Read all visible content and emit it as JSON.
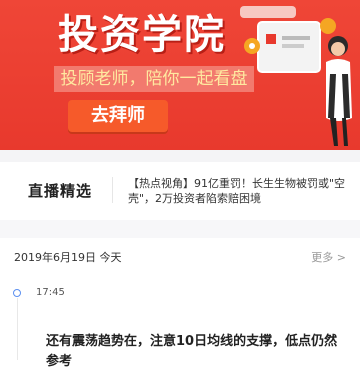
{
  "banner": {
    "title": "投资学院",
    "subtitle": "投顾老师，陪你一起看盘",
    "cta_label": "去拜师"
  },
  "live": {
    "tag": "直播精选",
    "news": "【热点视角】91亿重罚！长生生物被罚或\"空壳\"，2万投资者陷索赔困境"
  },
  "date_header": {
    "date": "2019年6月19日 今天",
    "more": "更多 >"
  },
  "timeline": {
    "time": "17:45",
    "text": "还有震荡趋势在，注意10日均线的支撑，低点仍然参考"
  },
  "colors": {
    "banner_red": "#e8392d",
    "cta_orange": "#f65a2a",
    "subtitle_yellow": "#ffe9a0",
    "timeline_dot": "#5b8ff0"
  }
}
